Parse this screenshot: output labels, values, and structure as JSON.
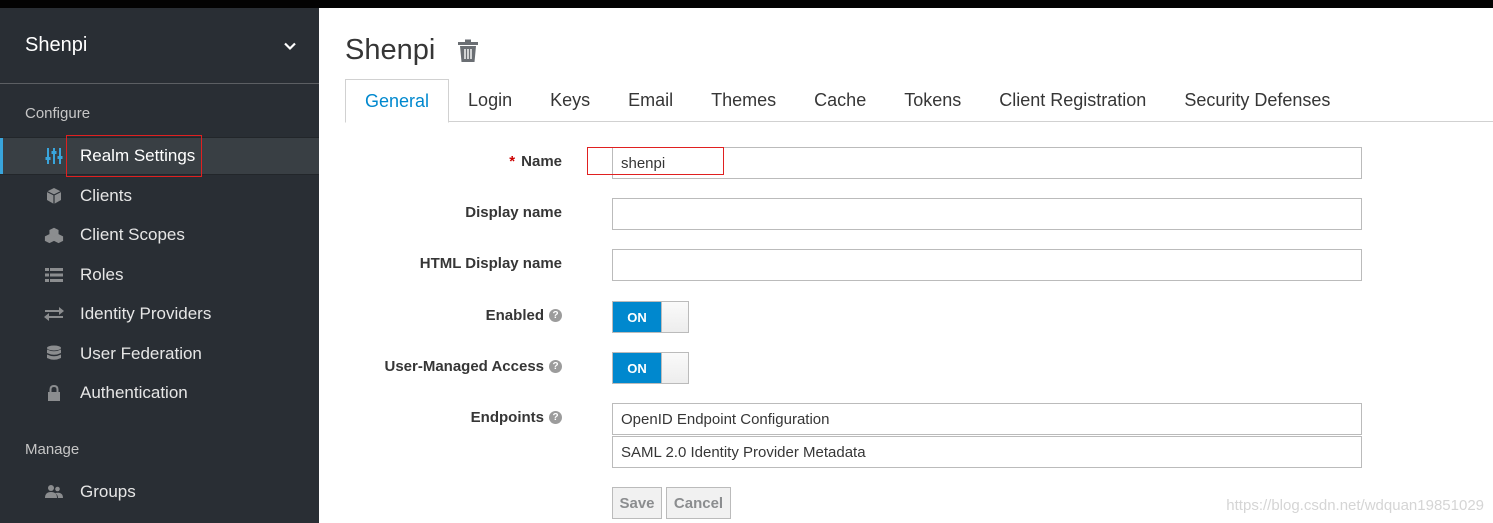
{
  "realm": {
    "name": "Shenpi"
  },
  "sidebar": {
    "configure_label": "Configure",
    "manage_label": "Manage",
    "configure_items": [
      {
        "label": "Realm Settings",
        "icon": "sliders-icon",
        "active": true
      },
      {
        "label": "Clients",
        "icon": "cube-icon"
      },
      {
        "label": "Client Scopes",
        "icon": "cubes-icon"
      },
      {
        "label": "Roles",
        "icon": "list-icon"
      },
      {
        "label": "Identity Providers",
        "icon": "exchange-icon"
      },
      {
        "label": "User Federation",
        "icon": "database-icon"
      },
      {
        "label": "Authentication",
        "icon": "lock-icon"
      }
    ],
    "manage_items": [
      {
        "label": "Groups",
        "icon": "users-icon"
      }
    ]
  },
  "header": {
    "title": "Shenpi"
  },
  "tabs": [
    {
      "label": "General",
      "active": true
    },
    {
      "label": "Login"
    },
    {
      "label": "Keys"
    },
    {
      "label": "Email"
    },
    {
      "label": "Themes"
    },
    {
      "label": "Cache"
    },
    {
      "label": "Tokens"
    },
    {
      "label": "Client Registration"
    },
    {
      "label": "Security Defenses"
    }
  ],
  "form": {
    "name": {
      "label": "Name",
      "required_mark": "*",
      "value": "shenpi"
    },
    "display_name": {
      "label": "Display name",
      "value": ""
    },
    "html_display_name": {
      "label": "HTML Display name",
      "value": ""
    },
    "enabled": {
      "label": "Enabled",
      "state": "ON",
      "help": "?"
    },
    "user_managed_access": {
      "label": "User-Managed Access",
      "state": "ON",
      "help": "?"
    },
    "endpoints": {
      "label": "Endpoints",
      "help": "?",
      "links": [
        "OpenID Endpoint Configuration",
        "SAML 2.0 Identity Provider Metadata"
      ]
    },
    "save_label": "Save",
    "cancel_label": "Cancel"
  },
  "watermark": "https://blog.csdn.net/wdquan19851029",
  "colors": {
    "sidebar_bg": "#292e34",
    "accent": "#0088ce",
    "highlight_box": "#e02020"
  }
}
